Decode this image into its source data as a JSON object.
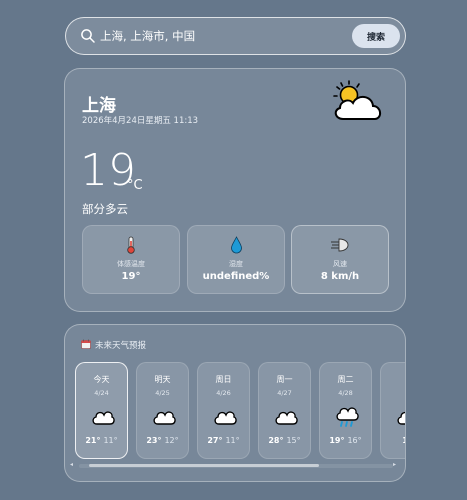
{
  "search": {
    "value": "上海, 上海市, 中国",
    "button_label": "搜索"
  },
  "current": {
    "city": "上海",
    "datetime": "2026年4月24日星期五 11:13",
    "temperature": "19",
    "unit": "°C",
    "condition": "部分多云",
    "icon": "partly-cloudy-icon"
  },
  "stats": [
    {
      "icon": "thermometer-icon",
      "label": "体感温度",
      "value": "19°"
    },
    {
      "icon": "droplet-icon",
      "label": "湿度",
      "value": "undefined%"
    },
    {
      "icon": "wind-icon",
      "label": "风速",
      "value": "8 km/h"
    }
  ],
  "forecast": {
    "title": "未来天气预报",
    "days": [
      {
        "name": "今天",
        "date": "4/24",
        "icon": "cloud-icon",
        "hi": "21°",
        "lo": "11°"
      },
      {
        "name": "明天",
        "date": "4/25",
        "icon": "cloud-icon",
        "hi": "23°",
        "lo": "12°"
      },
      {
        "name": "周日",
        "date": "4/26",
        "icon": "cloud-icon",
        "hi": "27°",
        "lo": "11°"
      },
      {
        "name": "周一",
        "date": "4/27",
        "icon": "cloud-icon",
        "hi": "28°",
        "lo": "15°"
      },
      {
        "name": "周二",
        "date": "4/28",
        "icon": "rain-cloud-icon",
        "hi": "19°",
        "lo": "16°"
      },
      {
        "name": "",
        "date": "",
        "icon": "cloud-icon",
        "hi": "1",
        "lo": ""
      }
    ]
  },
  "colors": {
    "background": "#65778b",
    "button": "#dbe3ee",
    "sun": "#f6c324",
    "rain": "#1e9ad6"
  }
}
